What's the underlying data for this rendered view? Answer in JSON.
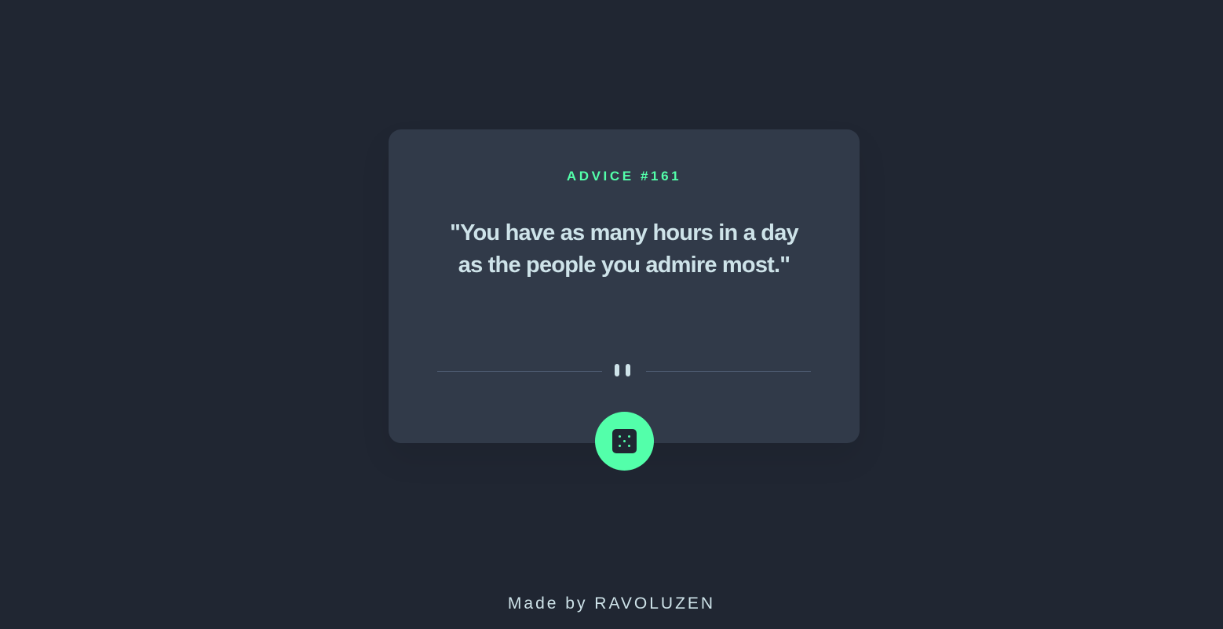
{
  "card": {
    "advice_id": "ADVICE #161",
    "quote": "\"You have as many hours in a day as the people you admire most.\""
  },
  "divider": {
    "icon": "pause-icon"
  },
  "button": {
    "icon": "dice-icon",
    "color": "#53ffaa"
  },
  "footer": {
    "text": "Made by RAVOLUZEN"
  },
  "colors": {
    "background": "#202632",
    "card": "#313a49",
    "accent": "#53ffaa",
    "text": "#cee3e9"
  }
}
